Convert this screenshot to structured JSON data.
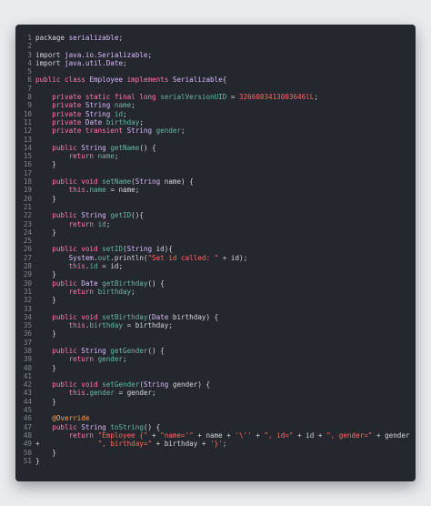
{
  "editor": {
    "theme": {
      "background": "#24272e",
      "page_background": "#e9ebee",
      "keyword": "#ff7ab2",
      "type": "#dabaff",
      "function": "#67b7a4",
      "string": "#fc6a5d",
      "number": "#d0bf69",
      "plain": "#d4d7dd",
      "annotation": "#ffa14f",
      "line_number": "#7f8691"
    },
    "lines": [
      {
        "n": "1",
        "tokens": [
          {
            "t": "package ",
            "c": "pl"
          },
          {
            "t": "serializable",
            "c": "ty"
          },
          {
            "t": ";",
            "c": "pl"
          }
        ]
      },
      {
        "n": "2",
        "tokens": []
      },
      {
        "n": "3",
        "tokens": [
          {
            "t": "import ",
            "c": "pl"
          },
          {
            "t": "java.io.Serializable",
            "c": "ty"
          },
          {
            "t": ";",
            "c": "pl"
          }
        ]
      },
      {
        "n": "4",
        "tokens": [
          {
            "t": "import ",
            "c": "pl"
          },
          {
            "t": "java.util.Date",
            "c": "ty"
          },
          {
            "t": ";",
            "c": "pl"
          }
        ]
      },
      {
        "n": "5",
        "tokens": []
      },
      {
        "n": "6",
        "tokens": [
          {
            "t": "public class ",
            "c": "kw"
          },
          {
            "t": "Employee ",
            "c": "ty"
          },
          {
            "t": "implements ",
            "c": "kw"
          },
          {
            "t": "Serializable",
            "c": "ty"
          },
          {
            "t": "{",
            "c": "pl"
          }
        ]
      },
      {
        "n": "7",
        "tokens": []
      },
      {
        "n": "8",
        "tokens": [
          {
            "t": "    private static final long ",
            "c": "kw"
          },
          {
            "t": "serialVersionUID",
            "c": "fn"
          },
          {
            "t": " = ",
            "c": "pl"
          },
          {
            "t": "3266083413003646lL",
            "c": "str"
          },
          {
            "t": ";",
            "c": "pl"
          }
        ]
      },
      {
        "n": "9",
        "tokens": [
          {
            "t": "    private ",
            "c": "kw"
          },
          {
            "t": "String ",
            "c": "ty"
          },
          {
            "t": "name",
            "c": "fn"
          },
          {
            "t": ";",
            "c": "pl"
          }
        ]
      },
      {
        "n": "10",
        "tokens": [
          {
            "t": "    private ",
            "c": "kw"
          },
          {
            "t": "String ",
            "c": "ty"
          },
          {
            "t": "id",
            "c": "fn"
          },
          {
            "t": ";",
            "c": "pl"
          }
        ]
      },
      {
        "n": "11",
        "tokens": [
          {
            "t": "    private ",
            "c": "kw"
          },
          {
            "t": "Date ",
            "c": "ty"
          },
          {
            "t": "birthday",
            "c": "fn"
          },
          {
            "t": ";",
            "c": "pl"
          }
        ]
      },
      {
        "n": "12",
        "tokens": [
          {
            "t": "    private transient ",
            "c": "kw"
          },
          {
            "t": "String ",
            "c": "ty"
          },
          {
            "t": "gender",
            "c": "fn"
          },
          {
            "t": ";",
            "c": "pl"
          }
        ]
      },
      {
        "n": "13",
        "tokens": []
      },
      {
        "n": "14",
        "tokens": [
          {
            "t": "    public ",
            "c": "kw"
          },
          {
            "t": "String ",
            "c": "ty"
          },
          {
            "t": "getName",
            "c": "fn"
          },
          {
            "t": "() {",
            "c": "pl"
          }
        ]
      },
      {
        "n": "15",
        "tokens": [
          {
            "t": "        return ",
            "c": "kw"
          },
          {
            "t": "name",
            "c": "fn"
          },
          {
            "t": ";",
            "c": "pl"
          }
        ]
      },
      {
        "n": "16",
        "tokens": [
          {
            "t": "    }",
            "c": "pl"
          }
        ]
      },
      {
        "n": "17",
        "tokens": []
      },
      {
        "n": "18",
        "tokens": [
          {
            "t": "    public void ",
            "c": "kw"
          },
          {
            "t": "setName",
            "c": "fn"
          },
          {
            "t": "(",
            "c": "pl"
          },
          {
            "t": "String ",
            "c": "ty"
          },
          {
            "t": "name) {",
            "c": "pl"
          }
        ]
      },
      {
        "n": "19",
        "tokens": [
          {
            "t": "        this",
            "c": "kw"
          },
          {
            "t": ".",
            "c": "pl"
          },
          {
            "t": "name",
            "c": "fn"
          },
          {
            "t": " = name;",
            "c": "pl"
          }
        ]
      },
      {
        "n": "20",
        "tokens": [
          {
            "t": "    }",
            "c": "pl"
          }
        ]
      },
      {
        "n": "21",
        "tokens": []
      },
      {
        "n": "22",
        "tokens": [
          {
            "t": "    public ",
            "c": "kw"
          },
          {
            "t": "String ",
            "c": "ty"
          },
          {
            "t": "getID",
            "c": "fn"
          },
          {
            "t": "(){",
            "c": "pl"
          }
        ]
      },
      {
        "n": "23",
        "tokens": [
          {
            "t": "        return ",
            "c": "kw"
          },
          {
            "t": "id",
            "c": "fn"
          },
          {
            "t": ";",
            "c": "pl"
          }
        ]
      },
      {
        "n": "24",
        "tokens": [
          {
            "t": "    }",
            "c": "pl"
          }
        ]
      },
      {
        "n": "25",
        "tokens": []
      },
      {
        "n": "26",
        "tokens": [
          {
            "t": "    public void ",
            "c": "kw"
          },
          {
            "t": "setID",
            "c": "fn"
          },
          {
            "t": "(",
            "c": "pl"
          },
          {
            "t": "String ",
            "c": "ty"
          },
          {
            "t": "id){",
            "c": "pl"
          }
        ]
      },
      {
        "n": "27",
        "tokens": [
          {
            "t": "        System",
            "c": "ty"
          },
          {
            "t": ".",
            "c": "pl"
          },
          {
            "t": "out",
            "c": "fn"
          },
          {
            "t": ".println(",
            "c": "pl"
          },
          {
            "t": "\"Set id called: \"",
            "c": "str"
          },
          {
            "t": " + id);",
            "c": "pl"
          }
        ]
      },
      {
        "n": "28",
        "tokens": [
          {
            "t": "        this",
            "c": "kw"
          },
          {
            "t": ".",
            "c": "pl"
          },
          {
            "t": "id",
            "c": "fn"
          },
          {
            "t": " = id;",
            "c": "pl"
          }
        ]
      },
      {
        "n": "29",
        "tokens": [
          {
            "t": "    }",
            "c": "pl"
          }
        ]
      },
      {
        "n": "30",
        "tokens": [
          {
            "t": "    public ",
            "c": "kw"
          },
          {
            "t": "Date ",
            "c": "ty"
          },
          {
            "t": "getBirthday",
            "c": "fn"
          },
          {
            "t": "() {",
            "c": "pl"
          }
        ]
      },
      {
        "n": "31",
        "tokens": [
          {
            "t": "        return ",
            "c": "kw"
          },
          {
            "t": "birthday",
            "c": "fn"
          },
          {
            "t": ";",
            "c": "pl"
          }
        ]
      },
      {
        "n": "32",
        "tokens": [
          {
            "t": "    }",
            "c": "pl"
          }
        ]
      },
      {
        "n": "33",
        "tokens": []
      },
      {
        "n": "34",
        "tokens": [
          {
            "t": "    public void ",
            "c": "kw"
          },
          {
            "t": "setBirthday",
            "c": "fn"
          },
          {
            "t": "(",
            "c": "pl"
          },
          {
            "t": "Date ",
            "c": "ty"
          },
          {
            "t": "birthday) {",
            "c": "pl"
          }
        ]
      },
      {
        "n": "35",
        "tokens": [
          {
            "t": "        this",
            "c": "kw"
          },
          {
            "t": ".",
            "c": "pl"
          },
          {
            "t": "birthday",
            "c": "fn"
          },
          {
            "t": " = birthday;",
            "c": "pl"
          }
        ]
      },
      {
        "n": "36",
        "tokens": [
          {
            "t": "    }",
            "c": "pl"
          }
        ]
      },
      {
        "n": "37",
        "tokens": []
      },
      {
        "n": "38",
        "tokens": [
          {
            "t": "    public ",
            "c": "kw"
          },
          {
            "t": "String ",
            "c": "ty"
          },
          {
            "t": "getGender",
            "c": "fn"
          },
          {
            "t": "() {",
            "c": "pl"
          }
        ]
      },
      {
        "n": "39",
        "tokens": [
          {
            "t": "        return ",
            "c": "kw"
          },
          {
            "t": "gender",
            "c": "fn"
          },
          {
            "t": ";",
            "c": "pl"
          }
        ]
      },
      {
        "n": "40",
        "tokens": [
          {
            "t": "    }",
            "c": "pl"
          }
        ]
      },
      {
        "n": "41",
        "tokens": []
      },
      {
        "n": "42",
        "tokens": [
          {
            "t": "    public void ",
            "c": "kw"
          },
          {
            "t": "setGender",
            "c": "fn"
          },
          {
            "t": "(",
            "c": "pl"
          },
          {
            "t": "String ",
            "c": "ty"
          },
          {
            "t": "gender) {",
            "c": "pl"
          }
        ]
      },
      {
        "n": "43",
        "tokens": [
          {
            "t": "        this",
            "c": "kw"
          },
          {
            "t": ".",
            "c": "pl"
          },
          {
            "t": "gender",
            "c": "fn"
          },
          {
            "t": " = gender;",
            "c": "pl"
          }
        ]
      },
      {
        "n": "44",
        "tokens": [
          {
            "t": "    }",
            "c": "pl"
          }
        ]
      },
      {
        "n": "45",
        "tokens": []
      },
      {
        "n": "46",
        "tokens": [
          {
            "t": "    @Override",
            "c": "an"
          }
        ]
      },
      {
        "n": "47",
        "tokens": [
          {
            "t": "    public ",
            "c": "kw"
          },
          {
            "t": "String ",
            "c": "ty"
          },
          {
            "t": "toString",
            "c": "fn"
          },
          {
            "t": "() {",
            "c": "pl"
          }
        ]
      },
      {
        "n": "48",
        "tokens": [
          {
            "t": "        return ",
            "c": "kw"
          },
          {
            "t": "\"Employee {\"",
            "c": "str"
          },
          {
            "t": " + ",
            "c": "pl"
          },
          {
            "t": "\"name='\"",
            "c": "str"
          },
          {
            "t": " + name + ",
            "c": "pl"
          },
          {
            "t": "'\\''",
            "c": "str"
          },
          {
            "t": " + ",
            "c": "pl"
          },
          {
            "t": "\", id=\"",
            "c": "str"
          },
          {
            "t": " + id + ",
            "c": "pl"
          },
          {
            "t": "\", gender=\"",
            "c": "str"
          },
          {
            "t": " + gender",
            "c": "pl"
          }
        ]
      },
      {
        "n": "49",
        "tokens": [
          {
            "t": "+              ",
            "c": "pl"
          },
          {
            "t": "\", birthday=\"",
            "c": "str"
          },
          {
            "t": " + birthday + ",
            "c": "pl"
          },
          {
            "t": "'}'",
            "c": "str"
          },
          {
            "t": ";",
            "c": "pl"
          }
        ]
      },
      {
        "n": "50",
        "tokens": [
          {
            "t": "    }",
            "c": "pl"
          }
        ]
      },
      {
        "n": "51",
        "tokens": [
          {
            "t": "}",
            "c": "pl"
          }
        ]
      }
    ]
  }
}
